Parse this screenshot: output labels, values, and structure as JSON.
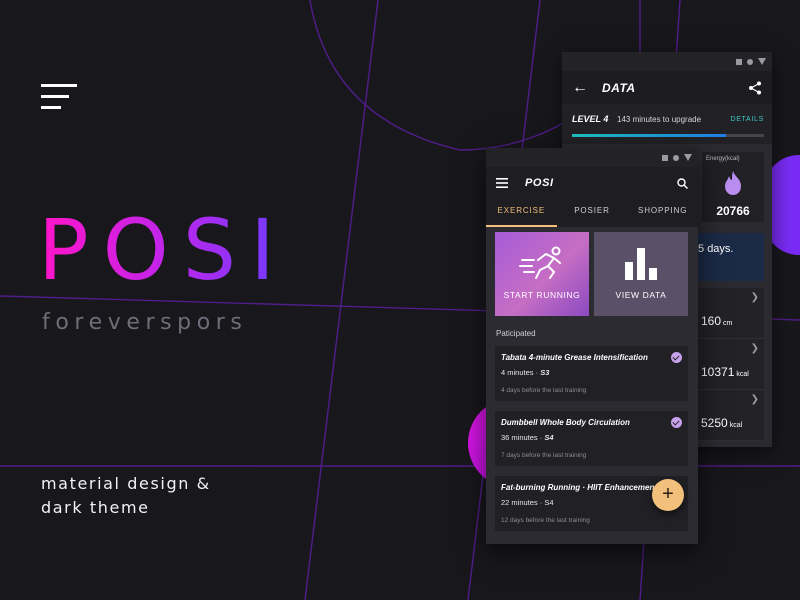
{
  "brand": {
    "title": "POSI",
    "subtitle": "foreverspors",
    "tagline_line1": "material design &",
    "tagline_line2": "dark theme"
  },
  "colors": {
    "background": "#18171c",
    "gradient_start": "#ff14c8",
    "gradient_end": "#6d3cff",
    "accent_gold": "#f2c07a",
    "accent_teal": "#3cc7c7",
    "check_purple": "#c7a0ea"
  },
  "data_screen": {
    "header": {
      "back_icon": "back-arrow-icon",
      "title": "DATA",
      "share_icon": "share-icon"
    },
    "level": {
      "label": "LEVEL 4",
      "text": "143 minutes to upgrade",
      "details_link": "DETAILS",
      "progress": 0.8
    },
    "energy": {
      "label": "Energy(kcal)",
      "icon": "flame-icon",
      "value": "20766"
    },
    "days": {
      "value": "5",
      "unit": "days."
    },
    "stats": [
      {
        "value": "160",
        "unit": "cm"
      },
      {
        "value": "10371",
        "unit": "kcal"
      },
      {
        "value": "5250",
        "unit": "kcal"
      }
    ]
  },
  "posi_screen": {
    "header": {
      "menu_icon": "hamburger-icon",
      "title": "POSI",
      "search_icon": "search-icon"
    },
    "tabs": [
      {
        "label": "EXERCISE",
        "active": true
      },
      {
        "label": "POSIER",
        "active": false
      },
      {
        "label": "SHOPPING",
        "active": false
      }
    ],
    "tiles": [
      {
        "label": "START RUNNING",
        "icon": "running-icon"
      },
      {
        "label": "VIEW DATA",
        "icon": "bar-chart-icon"
      }
    ],
    "section_label": "Paticipated",
    "cards": [
      {
        "title": "Tabata 4-minute Grease Intensification",
        "minutes": "4 minutes",
        "set": "S3",
        "foot": "4 days before the last training",
        "checked": true
      },
      {
        "title": "Dumbbell Whole Body Circulation",
        "minutes": "36 minutes",
        "set": "S4",
        "foot": "7 days before the last training",
        "checked": true
      },
      {
        "title": "Fat-burning Running · HIIT Enhancement",
        "minutes": "22 minutes",
        "set": "S4",
        "foot": "12 days before the last training",
        "checked": false
      }
    ],
    "fab_label": "+"
  }
}
